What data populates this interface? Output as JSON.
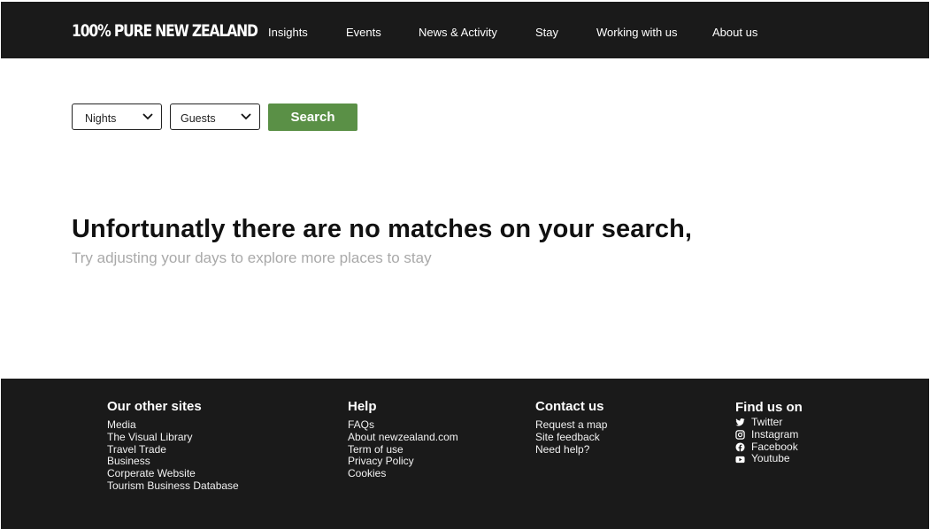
{
  "header": {
    "logo": "100% PURE NEW ZEALAND",
    "nav": [
      "Insights",
      "Events",
      "News & Activity",
      "Stay",
      "Working with us",
      "About us"
    ]
  },
  "search": {
    "nights_label": "Nights",
    "guests_label": "Guests",
    "button_label": "Search"
  },
  "message": {
    "headline": "Unfortunatly there are no matches on your search,",
    "subline": "Try adjusting your days to explore more places to stay"
  },
  "footer": {
    "other_sites": {
      "title": "Our other sites",
      "links": [
        "Media",
        "The Visual Library",
        "Travel Trade",
        "Business",
        "Corperate Website",
        "Tourism Business Database"
      ]
    },
    "help": {
      "title": "Help",
      "links": [
        "FAQs",
        "About newzealand.com",
        "Term of use",
        "Privacy Policy",
        "Cookies"
      ]
    },
    "contact": {
      "title": "Contact us",
      "links": [
        "Request a map",
        "Site feedback",
        "Need help?"
      ]
    },
    "social": {
      "title": "Find us on",
      "links": [
        {
          "label": "Twitter",
          "icon": "twitter-icon"
        },
        {
          "label": "Instagram",
          "icon": "instagram-icon"
        },
        {
          "label": "Facebook",
          "icon": "facebook-icon"
        },
        {
          "label": "Youtube",
          "icon": "youtube-icon"
        }
      ]
    }
  },
  "colors": {
    "dark": "#1a1a1a",
    "accent_green": "#5a9046",
    "muted_text": "#a9a9a9"
  }
}
